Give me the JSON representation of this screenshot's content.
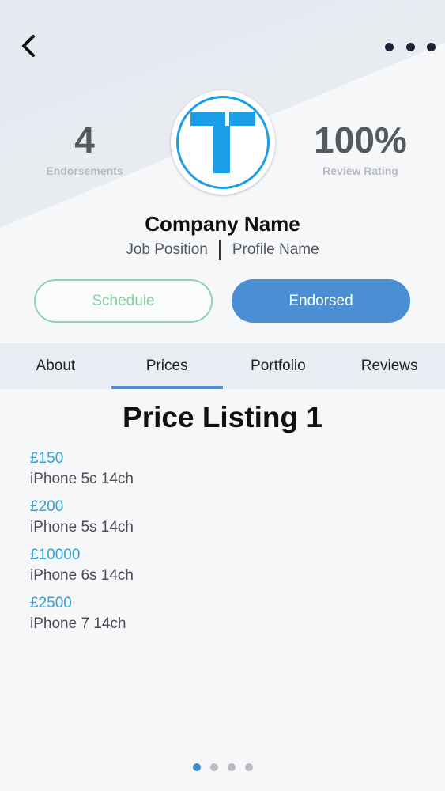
{
  "stats": {
    "endorsements_value": "4",
    "endorsements_label": "Endorsements",
    "rating_value": "100%",
    "rating_label": "Review Rating"
  },
  "profile": {
    "company_name": "Company Name",
    "job_position": "Job Position",
    "profile_name": "Profile Name"
  },
  "actions": {
    "schedule_label": "Schedule",
    "endorsed_label": "Endorsed"
  },
  "tabs": [
    {
      "label": "About"
    },
    {
      "label": "Prices",
      "active": true
    },
    {
      "label": "Portfolio"
    },
    {
      "label": "Reviews"
    }
  ],
  "listing": {
    "title": "Price Listing 1",
    "items": [
      {
        "price": "£150",
        "description": "iPhone 5c 14ch"
      },
      {
        "price": "£200",
        "description": "iPhone 5s 14ch"
      },
      {
        "price": "£10000",
        "description": "iPhone 6s 14ch"
      },
      {
        "price": "£2500",
        "description": "iPhone 7 14ch"
      }
    ]
  },
  "pager": {
    "page_count": 4,
    "current_page": 1
  },
  "colors": {
    "accent": "#4a8fd4",
    "logo_blue": "#1a9ee8",
    "price_blue": "#2fa3d9",
    "schedule_green": "#8fd3b0"
  },
  "icons": {
    "back": "chevron-left-icon",
    "more": "more-horizontal-icon",
    "logo": "company-logo-t"
  }
}
